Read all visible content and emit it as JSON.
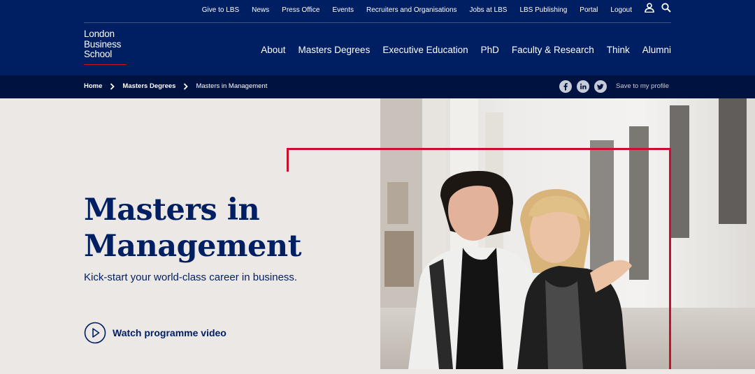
{
  "header": {
    "utility_links": [
      "Give to LBS",
      "News",
      "Press Office",
      "Events",
      "Recruiters and Organisations",
      "Jobs at LBS",
      "LBS Publishing",
      "Portal",
      "Logout"
    ],
    "logo_lines": [
      "London",
      "Business",
      "School"
    ],
    "main_nav": [
      "About",
      "Masters Degrees",
      "Executive Education",
      "PhD",
      "Faculty & Research",
      "Think",
      "Alumni"
    ]
  },
  "breadcrumb": {
    "items": [
      "Home",
      "Masters Degrees",
      "Masters in Management"
    ],
    "save_label": "Save to my profile"
  },
  "hero": {
    "title_line1": "Masters in",
    "title_line2": "Management",
    "subtitle": "Kick-start your world-class career in business.",
    "video_label": "Watch programme video"
  },
  "icons": {
    "user": "user-icon",
    "search": "search-icon",
    "chevron": "chevron-right-icon",
    "facebook": "facebook-icon",
    "linkedin": "linkedin-icon",
    "twitter": "twitter-icon",
    "play": "play-icon"
  },
  "colors": {
    "navy": "#001e62",
    "dark_navy": "#00123f",
    "accent_red": "#c8102e",
    "hero_background": "#ece8e5"
  }
}
